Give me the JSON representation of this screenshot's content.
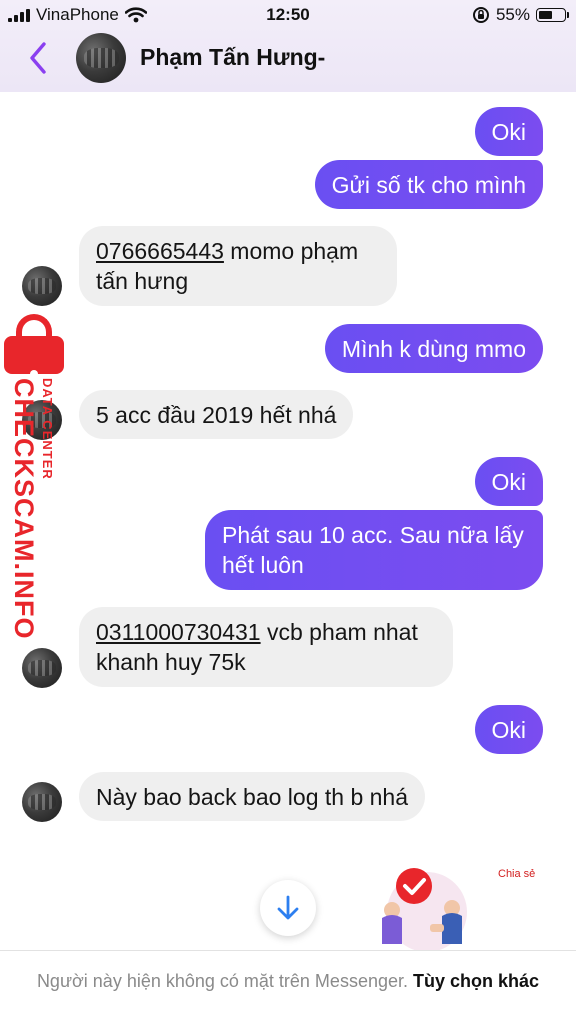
{
  "status_bar": {
    "carrier": "VinaPhone",
    "time": "12:50",
    "battery": "55%",
    "battery_level": 0.55
  },
  "header": {
    "contact_name": "Phạm Tấn Hưng-"
  },
  "messages": [
    {
      "side": "out",
      "text": "Oki"
    },
    {
      "side": "out",
      "text": "Gửi số tk cho mình"
    },
    {
      "side": "in",
      "number": "0766665443",
      "text": " momo phạm tấn hưng"
    },
    {
      "side": "out",
      "text": "Mình k dùng mmo"
    },
    {
      "side": "in",
      "text": "5 acc đầu 2019 hết nhá"
    },
    {
      "side": "out",
      "text": "Oki"
    },
    {
      "side": "out",
      "text": "Phát sau 10 acc. Sau nữa lấy hết luôn"
    },
    {
      "side": "in",
      "number": "0311000730431",
      "text": " vcb pham nhat khanh huy 75k"
    },
    {
      "side": "out",
      "text": "Oki"
    },
    {
      "side": "in",
      "text": "Này bao back bao log th b nhá"
    }
  ],
  "watermark": {
    "main": "CHECKSCAM.INFO",
    "sub": "DATA CENTER"
  },
  "share": {
    "label": "Chia sẻ"
  },
  "footer": {
    "notice": "Người này hiện không có mặt trên Messenger.",
    "more_options": "Tùy chọn khác"
  },
  "colors": {
    "outgoing_bubble": "#6a4ff2",
    "incoming_bubble": "#efefef",
    "accent": "#8a3ff0",
    "watermark": "#e8262b"
  }
}
